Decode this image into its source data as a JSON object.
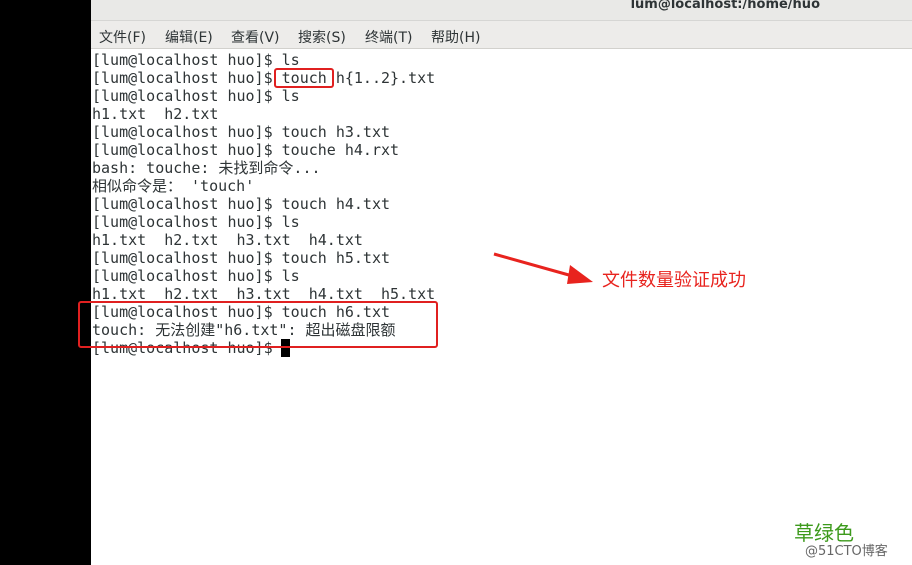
{
  "window": {
    "title": "lum@localhost:/home/huo"
  },
  "menubar": {
    "items": [
      {
        "label": "文件(F)"
      },
      {
        "label": "编辑(E)"
      },
      {
        "label": "查看(V)"
      },
      {
        "label": "搜索(S)"
      },
      {
        "label": "终端(T)"
      },
      {
        "label": "帮助(H)"
      }
    ]
  },
  "terminal": {
    "lines": [
      "[lum@localhost huo]$ ls",
      "[lum@localhost huo]$ touch h{1..2}.txt",
      "[lum@localhost huo]$ ls",
      "h1.txt  h2.txt",
      "[lum@localhost huo]$ touch h3.txt",
      "[lum@localhost huo]$ touche h4.rxt",
      "bash: touche: 未找到命令...",
      "相似命令是： 'touch'",
      "[lum@localhost huo]$ touch h4.txt",
      "[lum@localhost huo]$ ls",
      "h1.txt  h2.txt  h3.txt  h4.txt",
      "[lum@localhost huo]$ touch h5.txt",
      "[lum@localhost huo]$ ls",
      "h1.txt  h2.txt  h3.txt  h4.txt  h5.txt",
      "[lum@localhost huo]$ touch h6.txt",
      "touch: 无法创建\"h6.txt\": 超出磁盘限额",
      "[lum@localhost huo]$ "
    ]
  },
  "annotation": {
    "text": "文件数量验证成功",
    "color": "#e8231e"
  },
  "watermark": {
    "brand": "草绿色",
    "site": "@51CTO博客"
  },
  "colors": {
    "highlight": "#e02020",
    "brand_green": "#3d9a1c"
  }
}
